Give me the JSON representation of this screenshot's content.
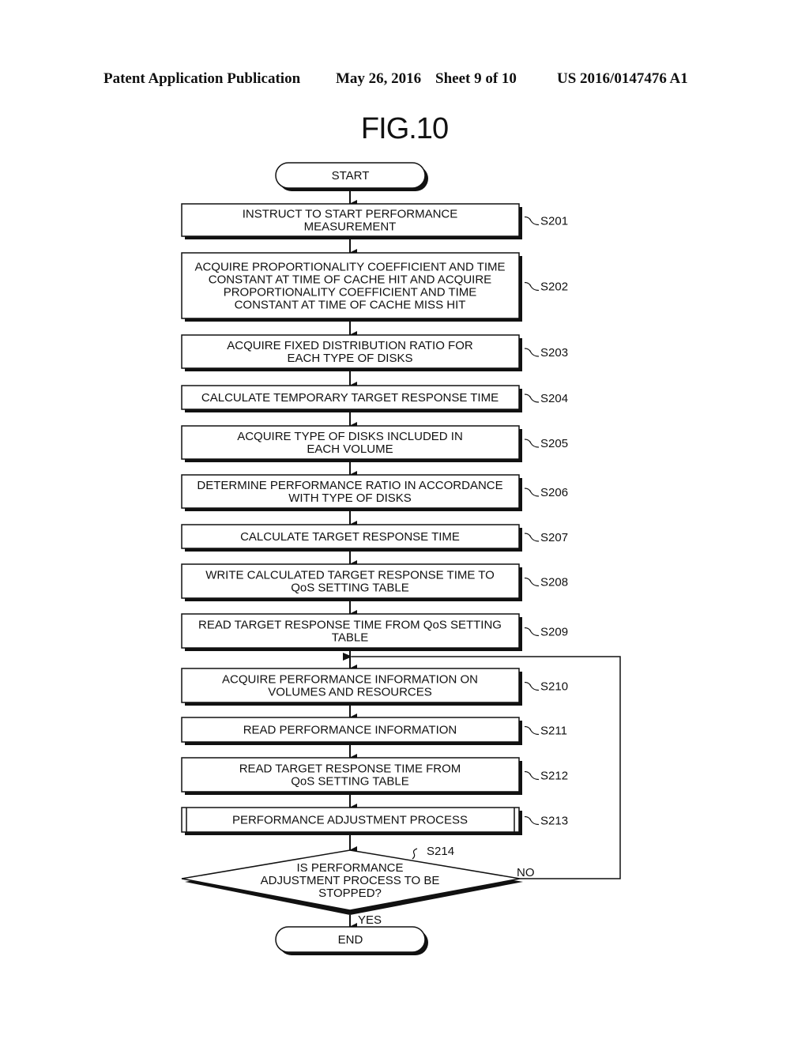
{
  "header": {
    "left": "Patent Application Publication",
    "date": "May 26, 2016",
    "sheet": "Sheet 9 of 10",
    "number": "US 2016/0147476 A1"
  },
  "figure": {
    "title": "FIG.10"
  },
  "flowchart": {
    "start": "START",
    "end": "END",
    "steps": [
      {
        "id": "S201",
        "lines": [
          "INSTRUCT TO START PERFORMANCE",
          "MEASUREMENT"
        ]
      },
      {
        "id": "S202",
        "lines": [
          "ACQUIRE PROPORTIONALITY COEFFICIENT AND TIME",
          "CONSTANT AT TIME OF CACHE HIT AND ACQUIRE",
          "PROPORTIONALITY COEFFICIENT AND TIME",
          "CONSTANT AT TIME OF CACHE MISS HIT"
        ]
      },
      {
        "id": "S203",
        "lines": [
          "ACQUIRE FIXED DISTRIBUTION RATIO FOR",
          "EACH TYPE OF DISKS"
        ]
      },
      {
        "id": "S204",
        "lines": [
          "CALCULATE TEMPORARY TARGET RESPONSE TIME"
        ]
      },
      {
        "id": "S205",
        "lines": [
          "ACQUIRE TYPE OF DISKS INCLUDED IN",
          "EACH VOLUME"
        ]
      },
      {
        "id": "S206",
        "lines": [
          "DETERMINE PERFORMANCE RATIO IN ACCORDANCE",
          "WITH TYPE OF DISKS"
        ]
      },
      {
        "id": "S207",
        "lines": [
          "CALCULATE TARGET RESPONSE TIME"
        ]
      },
      {
        "id": "S208",
        "lines": [
          "WRITE CALCULATED TARGET RESPONSE TIME TO",
          "QoS SETTING TABLE"
        ]
      },
      {
        "id": "S209",
        "lines": [
          "READ TARGET RESPONSE TIME FROM QoS SETTING",
          "TABLE"
        ]
      },
      {
        "id": "S210",
        "lines": [
          "ACQUIRE PERFORMANCE INFORMATION ON",
          "VOLUMES AND RESOURCES"
        ]
      },
      {
        "id": "S211",
        "lines": [
          "READ PERFORMANCE INFORMATION"
        ]
      },
      {
        "id": "S212",
        "lines": [
          "READ TARGET RESPONSE TIME FROM",
          "QoS SETTING TABLE"
        ]
      },
      {
        "id": "S213",
        "lines": [
          "PERFORMANCE ADJUSTMENT PROCESS"
        ],
        "predefined": true
      }
    ],
    "decision": {
      "id": "S214",
      "lines": [
        "IS PERFORMANCE",
        "ADJUSTMENT PROCESS TO BE",
        "STOPPED?"
      ],
      "yes": "YES",
      "no": "NO"
    }
  }
}
